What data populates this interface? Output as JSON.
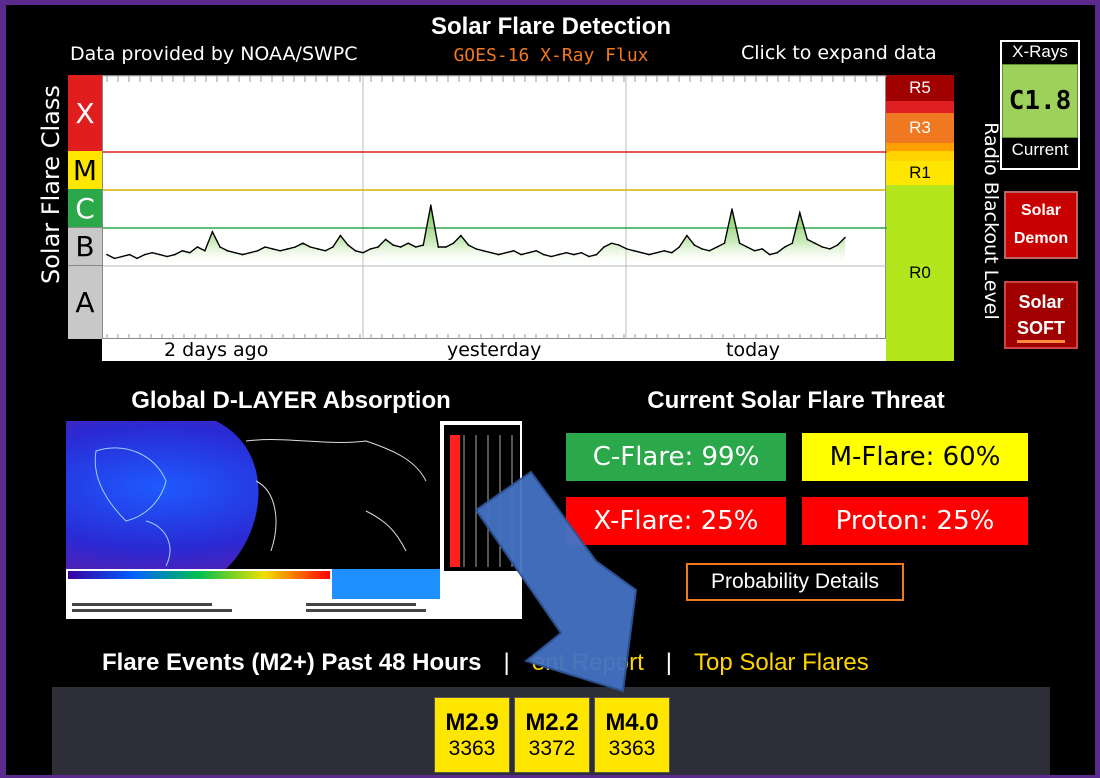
{
  "header": {
    "title": "Solar Flare Detection",
    "subtitle": "GOES-16 X-Ray Flux",
    "provider": "Data provided by NOAA/SWPC",
    "expand_link": "Click to expand data"
  },
  "chart_data": {
    "type": "line",
    "title": "GOES-16 X-Ray Flux",
    "ylabel": "Solar Flare Class",
    "y2label": "Radio Blackout Level",
    "y_classes": [
      "X",
      "M",
      "C",
      "B",
      "A"
    ],
    "class_colors": {
      "X": "#e01e1e",
      "M": "#ffe600",
      "C": "#2aa84a",
      "B": "#c8c8c8",
      "A": "#c8c8c8"
    },
    "radio_levels": [
      {
        "label": "R5",
        "color": "#a00000"
      },
      {
        "label": "R3",
        "color": "#f07820"
      },
      {
        "label": "R1",
        "color": "#ffe600"
      },
      {
        "label": "R0",
        "color": "#b4e61e"
      }
    ],
    "x_ticks": [
      "2 days ago",
      "yesterday",
      "today"
    ],
    "threshold_lines": [
      {
        "class": "X",
        "color": "#e01e1e"
      },
      {
        "class": "M",
        "color": "#d4b400"
      },
      {
        "class": "C",
        "color": "#2aa84a"
      }
    ],
    "series": [
      {
        "values": [
          1.3,
          1.2,
          1.25,
          1.3,
          1.2,
          1.3,
          1.35,
          1.3,
          1.25,
          1.3,
          1.4,
          1.35,
          1.5,
          1.4,
          1.9,
          1.5,
          1.4,
          1.35,
          1.3,
          1.35,
          1.4,
          1.5,
          1.45,
          1.4,
          1.45,
          1.5,
          1.6,
          1.5,
          1.45,
          1.4,
          1.5,
          1.8,
          1.55,
          1.4,
          1.35,
          1.45,
          1.5,
          1.7,
          1.55,
          1.5,
          1.6,
          1.5,
          1.55,
          2.6,
          1.5,
          1.5,
          1.6,
          1.8,
          1.55,
          1.45,
          1.4,
          1.35,
          1.3,
          1.35,
          1.4,
          1.3,
          1.35,
          1.4,
          1.3,
          1.25,
          1.3,
          1.35,
          1.3,
          1.35,
          1.25,
          1.3,
          1.5,
          1.6,
          1.55,
          1.45,
          1.4,
          1.35,
          1.3,
          1.35,
          1.4,
          1.35,
          1.5,
          1.8,
          1.55,
          1.45,
          1.4,
          1.5,
          1.6,
          2.5,
          1.6,
          1.5,
          1.4,
          1.45,
          1.3,
          1.35,
          1.5,
          1.6,
          2.4,
          1.7,
          1.6,
          1.5,
          1.45,
          1.55,
          1.75
        ]
      }
    ]
  },
  "xray_status": {
    "header": "X-Rays",
    "value": "C1.8",
    "footer": "Current"
  },
  "side_buttons": {
    "demon": {
      "line1": "Solar",
      "line2": "Demon"
    },
    "soft": {
      "line1": "Solar",
      "line2": "SOFT"
    }
  },
  "dlayer": {
    "title": "Global D-LAYER Absorption"
  },
  "threat": {
    "title": "Current Solar Flare Threat",
    "items": [
      {
        "label": "C-Flare: 99%",
        "color": "#2aa84a",
        "text_color": "#ffffff"
      },
      {
        "label": "M-Flare: 60%",
        "color": "#ffff00",
        "text_color": "#000000"
      },
      {
        "label": "X-Flare: 25%",
        "color": "#ff0000",
        "text_color": "#ffffff"
      },
      {
        "label": "Proton: 25%",
        "color": "#ff0000",
        "text_color": "#ffffff"
      }
    ],
    "details_button": "Probability Details"
  },
  "events": {
    "title": "Flare Events (M2+) Past 48 Hours",
    "separator": "|",
    "report_link": "ent Report",
    "top_link": "Top Solar Flares",
    "items": [
      {
        "class": "M2.9",
        "region": "3363"
      },
      {
        "class": "M2.2",
        "region": "3372"
      },
      {
        "class": "M4.0",
        "region": "3363"
      }
    ]
  }
}
